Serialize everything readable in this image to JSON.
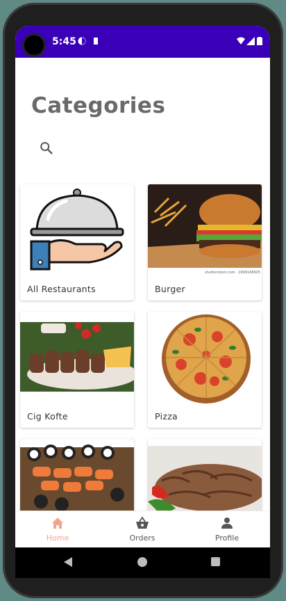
{
  "status_bar": {
    "time": "5:45"
  },
  "page": {
    "title": "Categories"
  },
  "categories": [
    {
      "label": "All Restaurants"
    },
    {
      "label": "Burger"
    },
    {
      "label": "Cig Kofte"
    },
    {
      "label": "Pizza"
    },
    {
      "label": ""
    },
    {
      "label": ""
    }
  ],
  "bottom_nav": {
    "items": [
      {
        "label": "Home",
        "icon": "home-icon",
        "active": true
      },
      {
        "label": "Orders",
        "icon": "basket-icon",
        "active": false
      },
      {
        "label": "Profile",
        "icon": "person-icon",
        "active": false
      }
    ]
  },
  "colors": {
    "status_bar": "#3a00b7",
    "active_nav": "#f2a58c",
    "inactive_nav": "#555555",
    "title": "#6a6a6a"
  }
}
